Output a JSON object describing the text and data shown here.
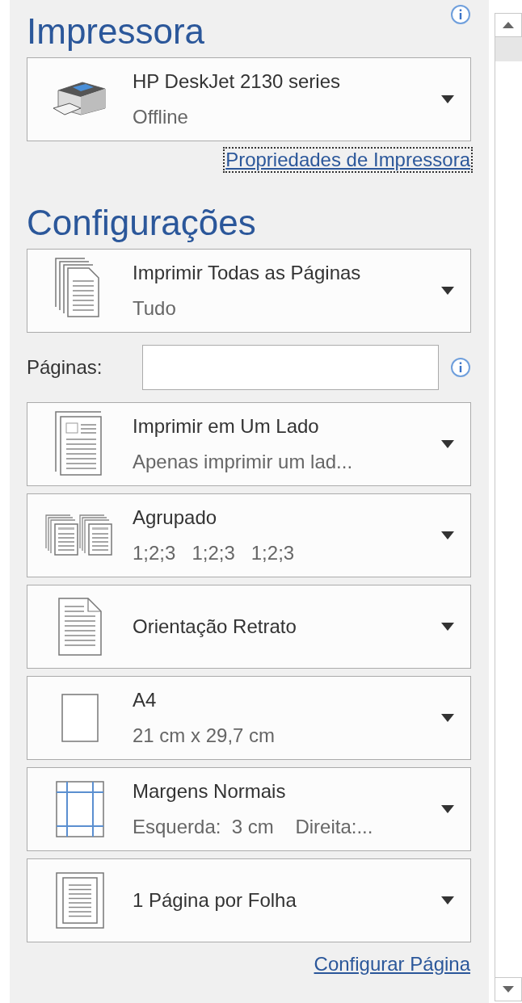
{
  "printer": {
    "heading": "Impressora",
    "device": {
      "kind": "printer",
      "title": "HP DeskJet 2130 series",
      "subtitle": "Offline"
    },
    "properties_link": {
      "label": "Propriedades de Impressora",
      "focused": true
    }
  },
  "settings": {
    "heading": "Configurações",
    "range": {
      "kind": "pages",
      "title": "Imprimir Todas as Páginas",
      "subtitle": "Tudo"
    },
    "pages_field": {
      "label": "Páginas:"
    },
    "dropdowns": [
      {
        "kind": "one-sided",
        "title": "Imprimir em Um Lado",
        "subtitle": "Apenas imprimir um lad..."
      },
      {
        "kind": "collated",
        "title": "Agrupado",
        "subtitle": "1;2;3   1;2;3   1;2;3"
      },
      {
        "kind": "portrait",
        "title": "Orientação Retrato"
      },
      {
        "kind": "paper",
        "title": "A4",
        "subtitle": "21 cm x 29,7 cm"
      },
      {
        "kind": "margins",
        "title": "Margens Normais",
        "subtitle": "Esquerda:  3 cm    Direita:..."
      },
      {
        "kind": "per-sheet",
        "title": "1 Página por Folha"
      }
    ],
    "page_setup_link": {
      "label": "Configurar Página"
    }
  }
}
